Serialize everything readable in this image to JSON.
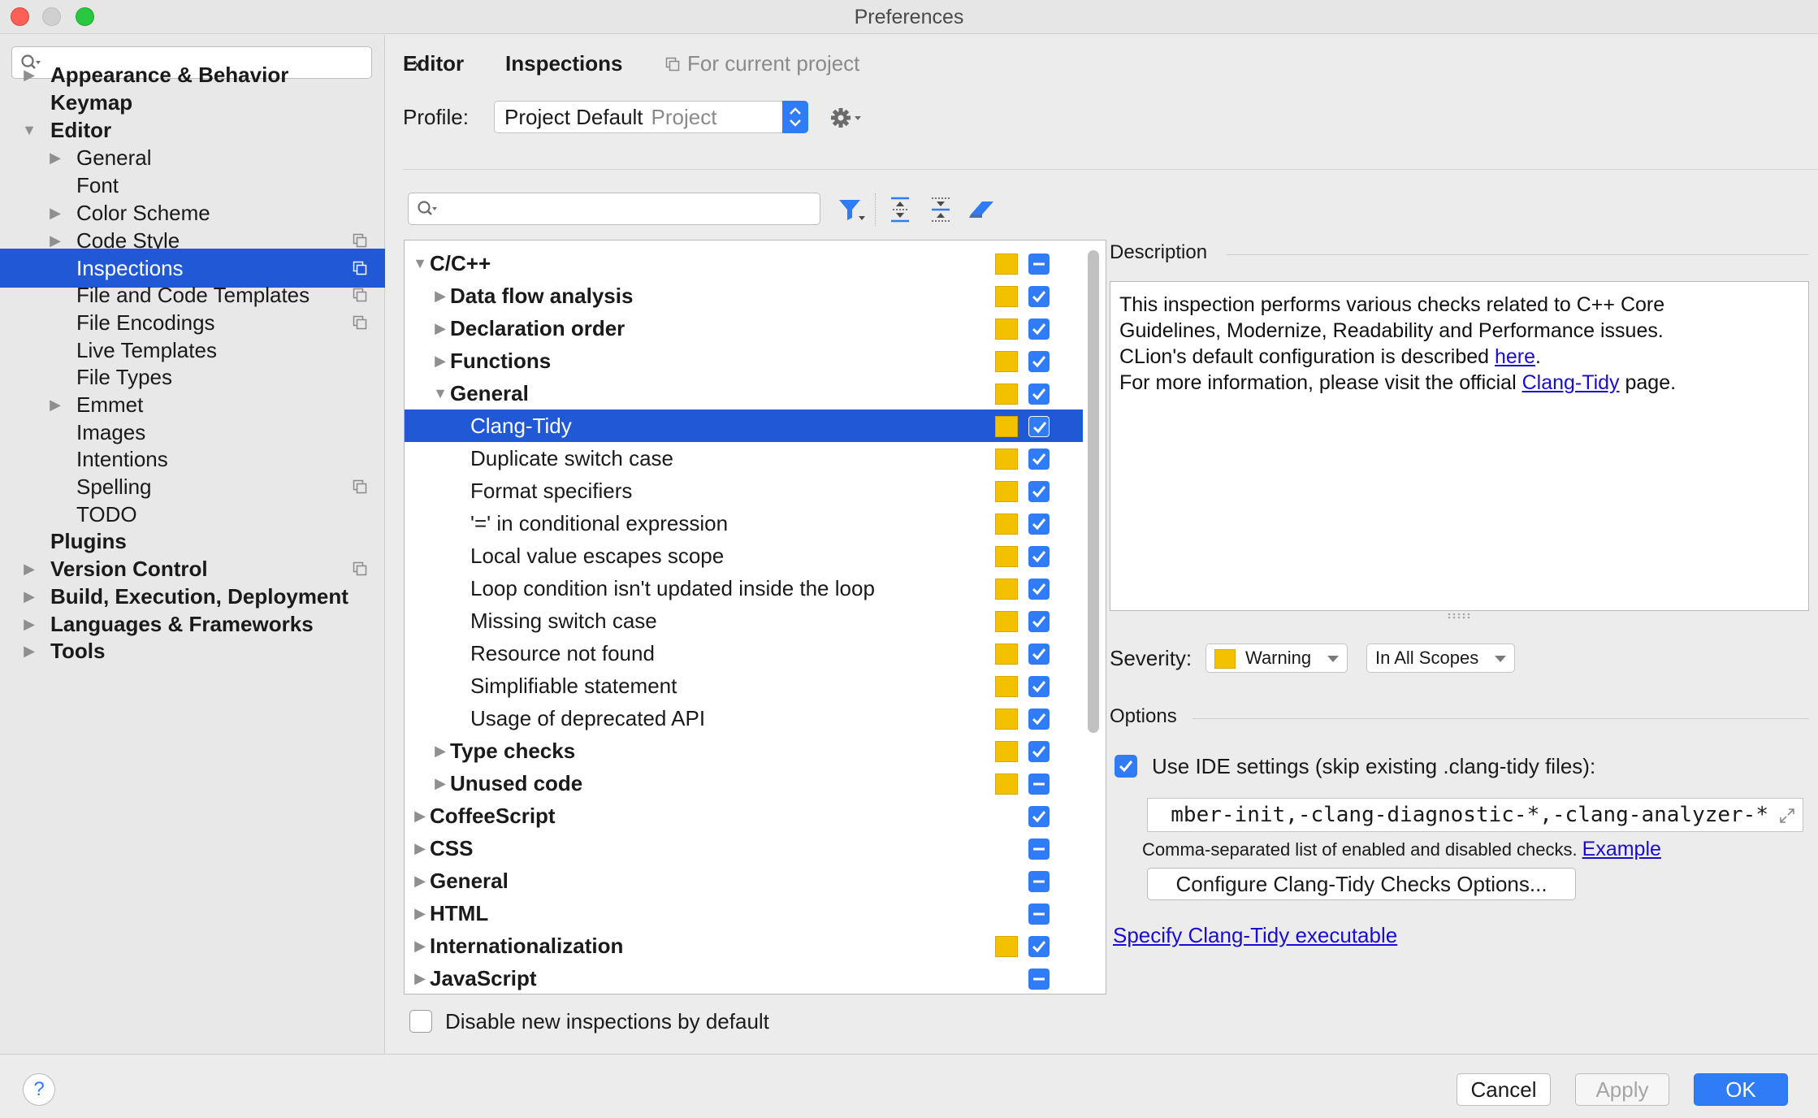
{
  "window": {
    "title": "Preferences"
  },
  "sidebar": {
    "search_placeholder": "",
    "items": [
      {
        "label": "Appearance & Behavior",
        "bold": true,
        "level": 0,
        "arrow": "right",
        "proj": false
      },
      {
        "label": "Keymap",
        "bold": true,
        "level": 0,
        "arrow": "none",
        "proj": false
      },
      {
        "label": "Editor",
        "bold": true,
        "level": 0,
        "arrow": "down",
        "proj": false
      },
      {
        "label": "General",
        "bold": false,
        "level": 1,
        "arrow": "right",
        "proj": false
      },
      {
        "label": "Font",
        "bold": false,
        "level": 1,
        "arrow": "none",
        "proj": false
      },
      {
        "label": "Color Scheme",
        "bold": false,
        "level": 1,
        "arrow": "right",
        "proj": false
      },
      {
        "label": "Code Style",
        "bold": false,
        "level": 1,
        "arrow": "right",
        "proj": true
      },
      {
        "label": "Inspections",
        "bold": false,
        "level": 1,
        "arrow": "none",
        "proj": true,
        "selected": true
      },
      {
        "label": "File and Code Templates",
        "bold": false,
        "level": 1,
        "arrow": "none",
        "proj": true
      },
      {
        "label": "File Encodings",
        "bold": false,
        "level": 1,
        "arrow": "none",
        "proj": true
      },
      {
        "label": "Live Templates",
        "bold": false,
        "level": 1,
        "arrow": "none",
        "proj": false
      },
      {
        "label": "File Types",
        "bold": false,
        "level": 1,
        "arrow": "none",
        "proj": false
      },
      {
        "label": "Emmet",
        "bold": false,
        "level": 1,
        "arrow": "right",
        "proj": false
      },
      {
        "label": "Images",
        "bold": false,
        "level": 1,
        "arrow": "none",
        "proj": false
      },
      {
        "label": "Intentions",
        "bold": false,
        "level": 1,
        "arrow": "none",
        "proj": false
      },
      {
        "label": "Spelling",
        "bold": false,
        "level": 1,
        "arrow": "none",
        "proj": true
      },
      {
        "label": "TODO",
        "bold": false,
        "level": 1,
        "arrow": "none",
        "proj": false
      },
      {
        "label": "Plugins",
        "bold": true,
        "level": 0,
        "arrow": "none",
        "proj": false
      },
      {
        "label": "Version Control",
        "bold": true,
        "level": 0,
        "arrow": "right",
        "proj": true
      },
      {
        "label": "Build, Execution, Deployment",
        "bold": true,
        "level": 0,
        "arrow": "right",
        "proj": false
      },
      {
        "label": "Languages & Frameworks",
        "bold": true,
        "level": 0,
        "arrow": "right",
        "proj": false
      },
      {
        "label": "Tools",
        "bold": true,
        "level": 0,
        "arrow": "right",
        "proj": false
      }
    ]
  },
  "breadcrumb": {
    "parent": "Editor",
    "separator": "›",
    "current": "Inspections",
    "scope_note": "For current project"
  },
  "profile": {
    "label": "Profile:",
    "value": "Project Default",
    "sub": "Project"
  },
  "inspection_search_placeholder": "",
  "tree": [
    {
      "label": "C/C++",
      "bold": true,
      "level": 0,
      "arrow": "down",
      "severity": true,
      "check": "partial"
    },
    {
      "label": "Data flow analysis",
      "bold": true,
      "level": 1,
      "arrow": "right",
      "severity": true,
      "check": "checked"
    },
    {
      "label": "Declaration order",
      "bold": true,
      "level": 1,
      "arrow": "right",
      "severity": true,
      "check": "checked"
    },
    {
      "label": "Functions",
      "bold": true,
      "level": 1,
      "arrow": "right",
      "severity": true,
      "check": "checked"
    },
    {
      "label": "General",
      "bold": true,
      "level": 1,
      "arrow": "down",
      "severity": true,
      "check": "checked"
    },
    {
      "label": "Clang-Tidy",
      "bold": false,
      "level": 2,
      "arrow": "none",
      "severity": true,
      "check": "checked",
      "selected": true
    },
    {
      "label": "Duplicate switch case",
      "bold": false,
      "level": 2,
      "arrow": "none",
      "severity": true,
      "check": "checked"
    },
    {
      "label": "Format specifiers",
      "bold": false,
      "level": 2,
      "arrow": "none",
      "severity": true,
      "check": "checked"
    },
    {
      "label": "'=' in conditional expression",
      "bold": false,
      "level": 2,
      "arrow": "none",
      "severity": true,
      "check": "checked"
    },
    {
      "label": "Local value escapes scope",
      "bold": false,
      "level": 2,
      "arrow": "none",
      "severity": true,
      "check": "checked"
    },
    {
      "label": "Loop condition isn't updated inside the loop",
      "bold": false,
      "level": 2,
      "arrow": "none",
      "severity": true,
      "check": "checked"
    },
    {
      "label": "Missing switch case",
      "bold": false,
      "level": 2,
      "arrow": "none",
      "severity": true,
      "check": "checked"
    },
    {
      "label": "Resource not found",
      "bold": false,
      "level": 2,
      "arrow": "none",
      "severity": true,
      "check": "checked"
    },
    {
      "label": "Simplifiable statement",
      "bold": false,
      "level": 2,
      "arrow": "none",
      "severity": true,
      "check": "checked"
    },
    {
      "label": "Usage of deprecated API",
      "bold": false,
      "level": 2,
      "arrow": "none",
      "severity": true,
      "check": "checked"
    },
    {
      "label": "Type checks",
      "bold": true,
      "level": 1,
      "arrow": "right",
      "severity": true,
      "check": "checked"
    },
    {
      "label": "Unused code",
      "bold": true,
      "level": 1,
      "arrow": "right",
      "severity": true,
      "check": "partial"
    },
    {
      "label": "CoffeeScript",
      "bold": true,
      "level": 0,
      "arrow": "right",
      "severity": false,
      "check": "checked"
    },
    {
      "label": "CSS",
      "bold": true,
      "level": 0,
      "arrow": "right",
      "severity": false,
      "check": "partial"
    },
    {
      "label": "General",
      "bold": true,
      "level": 0,
      "arrow": "right",
      "severity": false,
      "check": "partial"
    },
    {
      "label": "HTML",
      "bold": true,
      "level": 0,
      "arrow": "right",
      "severity": false,
      "check": "partial"
    },
    {
      "label": "Internationalization",
      "bold": true,
      "level": 0,
      "arrow": "right",
      "severity": true,
      "check": "checked"
    },
    {
      "label": "JavaScript",
      "bold": true,
      "level": 0,
      "arrow": "right",
      "severity": false,
      "check": "partial"
    }
  ],
  "disable_new": {
    "label": "Disable new inspections by default",
    "checked": false
  },
  "description": {
    "title": "Description",
    "line1": "This inspection performs various checks related to C++ Core",
    "line2": "Guidelines, Modernize, Readability and Performance issues.",
    "line3_pre": "CLion's default configuration is described ",
    "line3_link": "here",
    "line3_post": ".",
    "line4_pre": "For more information, please visit the official ",
    "line4_link": "Clang-Tidy",
    "line4_post": " page."
  },
  "severity": {
    "label": "Severity:",
    "value": "Warning",
    "scope": "In All Scopes"
  },
  "options": {
    "title": "Options",
    "use_ide_label": "Use IDE settings (skip existing .clang-tidy files):",
    "use_ide_checked": true,
    "checks_value": "mber-init,-clang-diagnostic-*,-clang-analyzer-*",
    "hint": "Comma-separated list of enabled and disabled checks.",
    "hint_link": "Example",
    "configure_button": "Configure Clang-Tidy Checks Options...",
    "specify_link": "Specify Clang-Tidy executable"
  },
  "footer": {
    "help": "?",
    "cancel": "Cancel",
    "apply": "Apply",
    "ok": "OK"
  },
  "colors": {
    "accent": "#2f7cf6",
    "selection": "#2158d6",
    "warning": "#f2c200",
    "link": "#1a0dcc"
  },
  "icons": {
    "search": "search-icon",
    "gear": "gear-icon",
    "filter": "filter-icon",
    "expand_all": "expand-all-icon",
    "collapse_all": "collapse-all-icon",
    "reset": "eraser-icon",
    "project_scope": "project-scope-icon",
    "help": "help-icon"
  }
}
